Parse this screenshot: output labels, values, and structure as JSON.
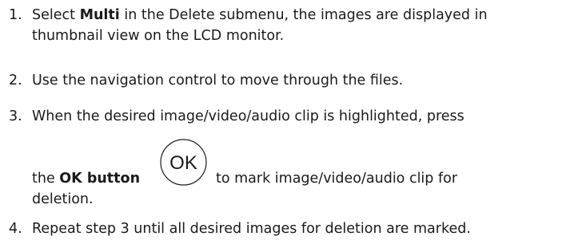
{
  "steps": [
    {
      "number": "1.",
      "pre": "Select ",
      "bold": "Multi",
      "post": " in the Delete submenu, the images are displayed in",
      "line2": "thumbnail view on the LCD monitor."
    },
    {
      "number": "2.",
      "text": "Use the navigation control to move through the files."
    },
    {
      "number": "3.",
      "line1": "When the desired image/video/audio clip is highlighted, press",
      "pre": "the ",
      "bold": "OK button",
      "icon_label": "OK",
      "post": "to mark image/video/audio clip for",
      "line3": "deletion."
    },
    {
      "number": "4.",
      "text": "Repeat step 3 until all desired images for deletion are marked."
    }
  ]
}
